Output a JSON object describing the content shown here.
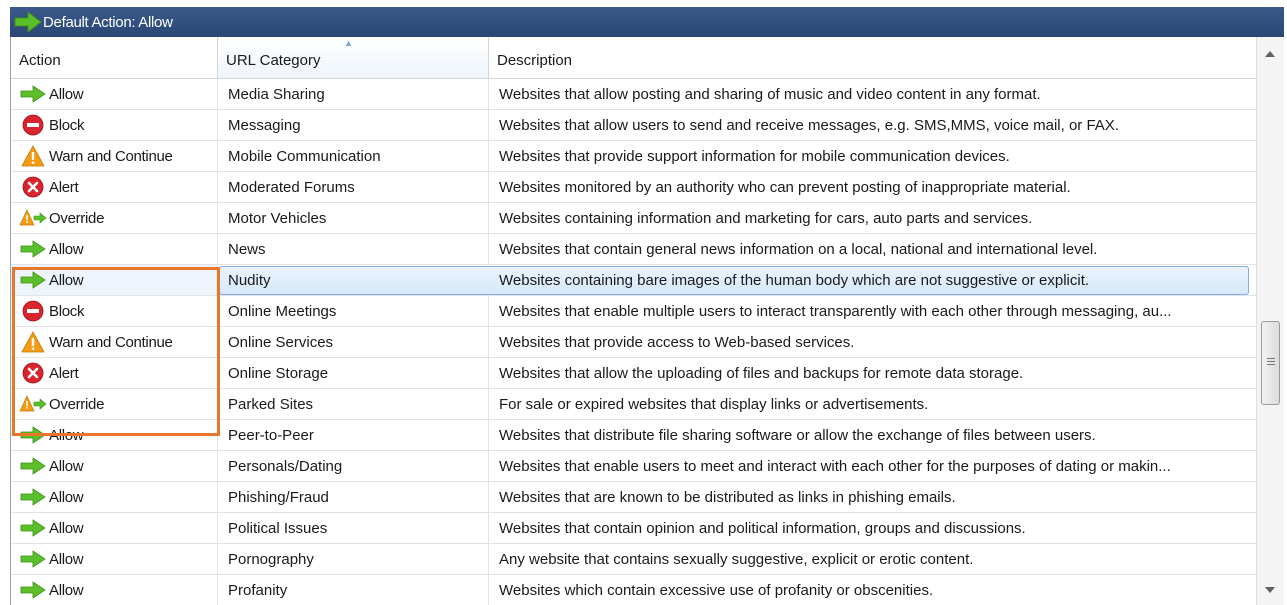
{
  "title_bar": {
    "text": "Default Action: Allow"
  },
  "columns": [
    "Action",
    "URL Category",
    "Description"
  ],
  "rows": [
    {
      "action": "Allow",
      "icon": "allow-arrow-icon",
      "category": "Media Sharing",
      "description": "Websites that allow posting and sharing of music and video content in any format."
    },
    {
      "action": "Block",
      "icon": "block-icon",
      "category": "Messaging",
      "description": "Websites that allow users to send and receive messages, e.g. SMS,MMS, voice mail, or FAX."
    },
    {
      "action": "Warn and Continue",
      "icon": "warning-icon",
      "category": "Mobile Communication",
      "description": "Websites that provide support information for mobile communication devices."
    },
    {
      "action": "Alert",
      "icon": "alert-x-icon",
      "category": "Moderated Forums",
      "description": "Websites monitored by an authority who can prevent posting of inappropriate material."
    },
    {
      "action": "Override",
      "icon": "override-icon",
      "category": "Motor Vehicles",
      "description": "Websites containing information and marketing for cars, auto parts and services."
    },
    {
      "action": "Allow",
      "icon": "allow-arrow-icon",
      "category": "News",
      "description": "Websites that contain general news information on a local, national and international level."
    },
    {
      "action": "Allow",
      "icon": "allow-arrow-icon",
      "category": "Nudity",
      "description": "Websites containing bare images of the human body which are not suggestive or explicit.",
      "selected": true
    },
    {
      "action": "Block",
      "icon": "block-icon",
      "category": "Online Meetings",
      "description": "Websites that enable multiple users to interact transparently with each other through messaging, au..."
    },
    {
      "action": "Warn and Continue",
      "icon": "warning-icon",
      "category": "Online Services",
      "description": "Websites that provide access to Web-based services."
    },
    {
      "action": "Alert",
      "icon": "alert-x-icon",
      "category": "Online Storage",
      "description": "Websites that allow the uploading of files and backups for remote data storage."
    },
    {
      "action": "Override",
      "icon": "override-icon",
      "category": "Parked Sites",
      "description": "For sale or expired websites that display links or advertisements."
    },
    {
      "action": "Allow",
      "icon": "allow-arrow-icon",
      "category": "Peer-to-Peer",
      "description": "Websites that distribute file sharing software or allow the exchange of files between users."
    },
    {
      "action": "Allow",
      "icon": "allow-arrow-icon",
      "category": "Personals/Dating",
      "description": "Websites that enable users to meet and interact with each other for the purposes of dating or makin..."
    },
    {
      "action": "Allow",
      "icon": "allow-arrow-icon",
      "category": "Phishing/Fraud",
      "description": "Websites that are known to be distributed as links in phishing emails."
    },
    {
      "action": "Allow",
      "icon": "allow-arrow-icon",
      "category": "Political Issues",
      "description": "Websites that contain opinion and political information, groups and discussions."
    },
    {
      "action": "Allow",
      "icon": "allow-arrow-icon",
      "category": "Pornography",
      "description": "Any website that contains sexually suggestive, explicit or erotic content."
    },
    {
      "action": "Allow",
      "icon": "allow-arrow-icon",
      "category": "Profanity",
      "description": "Websites which contain excessive use of profanity or obscenities."
    }
  ],
  "colors": {
    "allow": "#5bbf2a",
    "block": "#d9232d",
    "warn": "#f39c12",
    "alert": "#d9232d",
    "highlight": "#e8762b",
    "title_bg": "#2f4f80"
  },
  "sort": {
    "column": "URL Category",
    "direction": "ascending"
  }
}
